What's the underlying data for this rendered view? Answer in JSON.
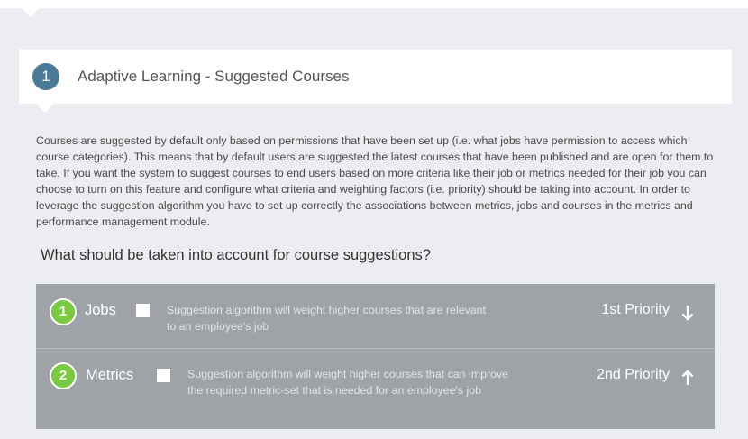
{
  "section": {
    "step_number": "1",
    "title": "Adaptive Learning - Suggested Courses",
    "description": "Courses are suggested by default only based on permissions that have been set up (i.e. what jobs have permission to access which course categories). This means that by default users are suggested the latest courses that have been published and are open for them to take. If you want the system to suggest courses to end users based on more criteria like their job or metrics needed for their job you can choose to turn on this feature and configure what criteria and weighting factors (i.e. priority) should be taking into account. In order to leverage the suggestion algorithm you have to set up correctly the associations between metrics, jobs and courses in the metrics and performance management module.",
    "question": "What should be taken into account for course suggestions?"
  },
  "criteria": [
    {
      "number": "1",
      "name": "Jobs",
      "checked": false,
      "description": "Suggestion algorithm will weight higher courses that are relevant to an employee's job",
      "priority": "1st Priority",
      "arrow_icon": "arrow-down-icon"
    },
    {
      "number": "2",
      "name": "Metrics",
      "checked": false,
      "description": "Suggestion algorithm will weight higher courses that can improve the required metric-set that is needed for an employee's job",
      "priority": "2nd Priority",
      "arrow_icon": "arrow-up-icon"
    }
  ],
  "colors": {
    "page_bg": "#ecedf1",
    "step_circle": "#4a7a96",
    "criteria_bg": "#9fa3a7",
    "badge_green": "#7ac943"
  }
}
